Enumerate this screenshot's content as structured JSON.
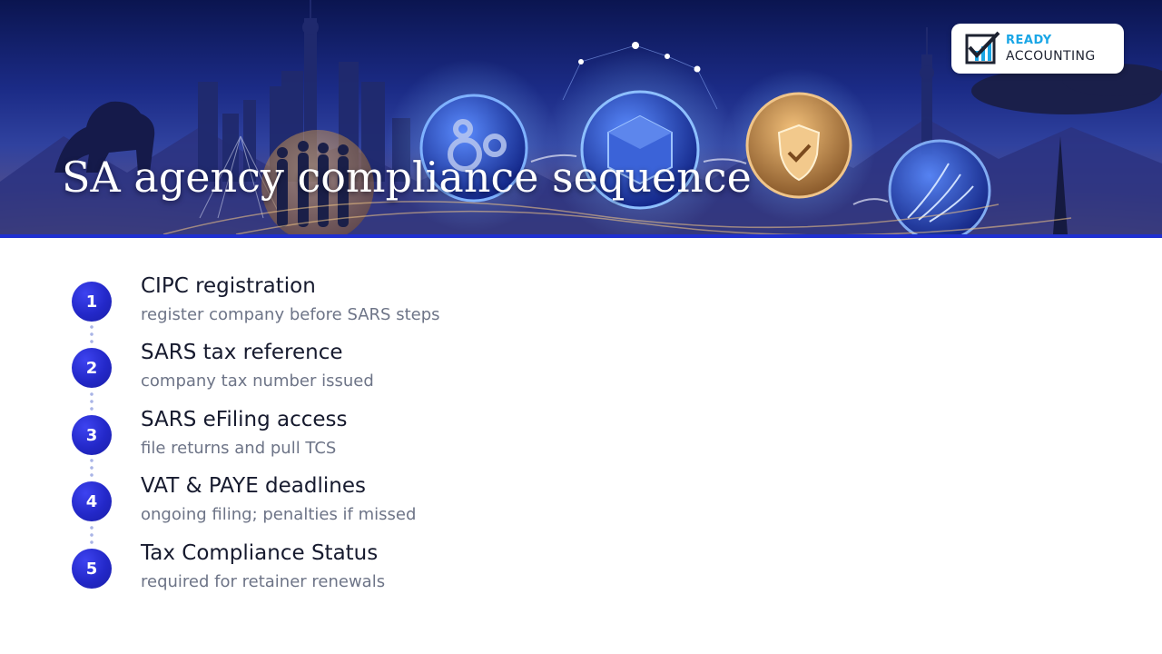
{
  "banner": {
    "title": "SA agency compliance sequence"
  },
  "logo": {
    "line1": "READY",
    "line2": "ACCOUNTING",
    "icon": "checkmark-bar-chart-icon"
  },
  "colors": {
    "accent": "#1f2fd0",
    "badge": "#2328c8",
    "title_text": "#161a2e",
    "desc_text": "#6d7487",
    "logo_blue": "#1aa6e6"
  },
  "steps": [
    {
      "number": "1",
      "title": "CIPC registration",
      "description": "register company before SARS steps"
    },
    {
      "number": "2",
      "title": "SARS tax reference",
      "description": "company tax number issued"
    },
    {
      "number": "3",
      "title": "SARS eFiling access",
      "description": "file returns and pull TCS"
    },
    {
      "number": "4",
      "title": "VAT & PAYE deadlines",
      "description": "ongoing filing; penalties if missed"
    },
    {
      "number": "5",
      "title": "Tax Compliance Status",
      "description": "required for retainer renewals"
    }
  ]
}
